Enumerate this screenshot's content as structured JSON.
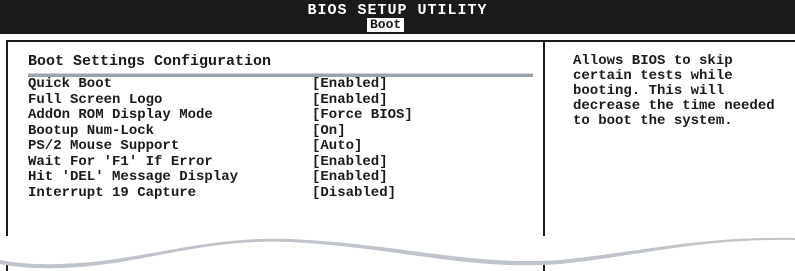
{
  "header": {
    "title": "BIOS SETUP UTILITY",
    "active_tab": "Boot"
  },
  "main": {
    "section_title": "Boot Settings Configuration",
    "settings": [
      {
        "label": "Quick Boot",
        "value": "[Enabled]"
      },
      {
        "label": "Full Screen Logo",
        "value": "[Enabled]"
      },
      {
        "label": "AddOn ROM Display Mode",
        "value": "[Force BIOS]"
      },
      {
        "label": "Bootup Num-Lock",
        "value": "[On]"
      },
      {
        "label": "PS/2 Mouse Support",
        "value": "[Auto]"
      },
      {
        "label": "Wait For 'F1' If Error",
        "value": "[Enabled]"
      },
      {
        "label": "Hit 'DEL' Message Display",
        "value": "[Enabled]"
      },
      {
        "label": "Interrupt 19 Capture",
        "value": "[Disabled]"
      }
    ]
  },
  "help_panel": {
    "text": "Allows BIOS to skip certain tests while booting. This will decrease the time needed to boot the system."
  },
  "colors": {
    "bar_background": "#1a1a1a",
    "text": "#1a1a1a",
    "divider": "#9aa2ad",
    "wave": "#bfc4ca"
  }
}
